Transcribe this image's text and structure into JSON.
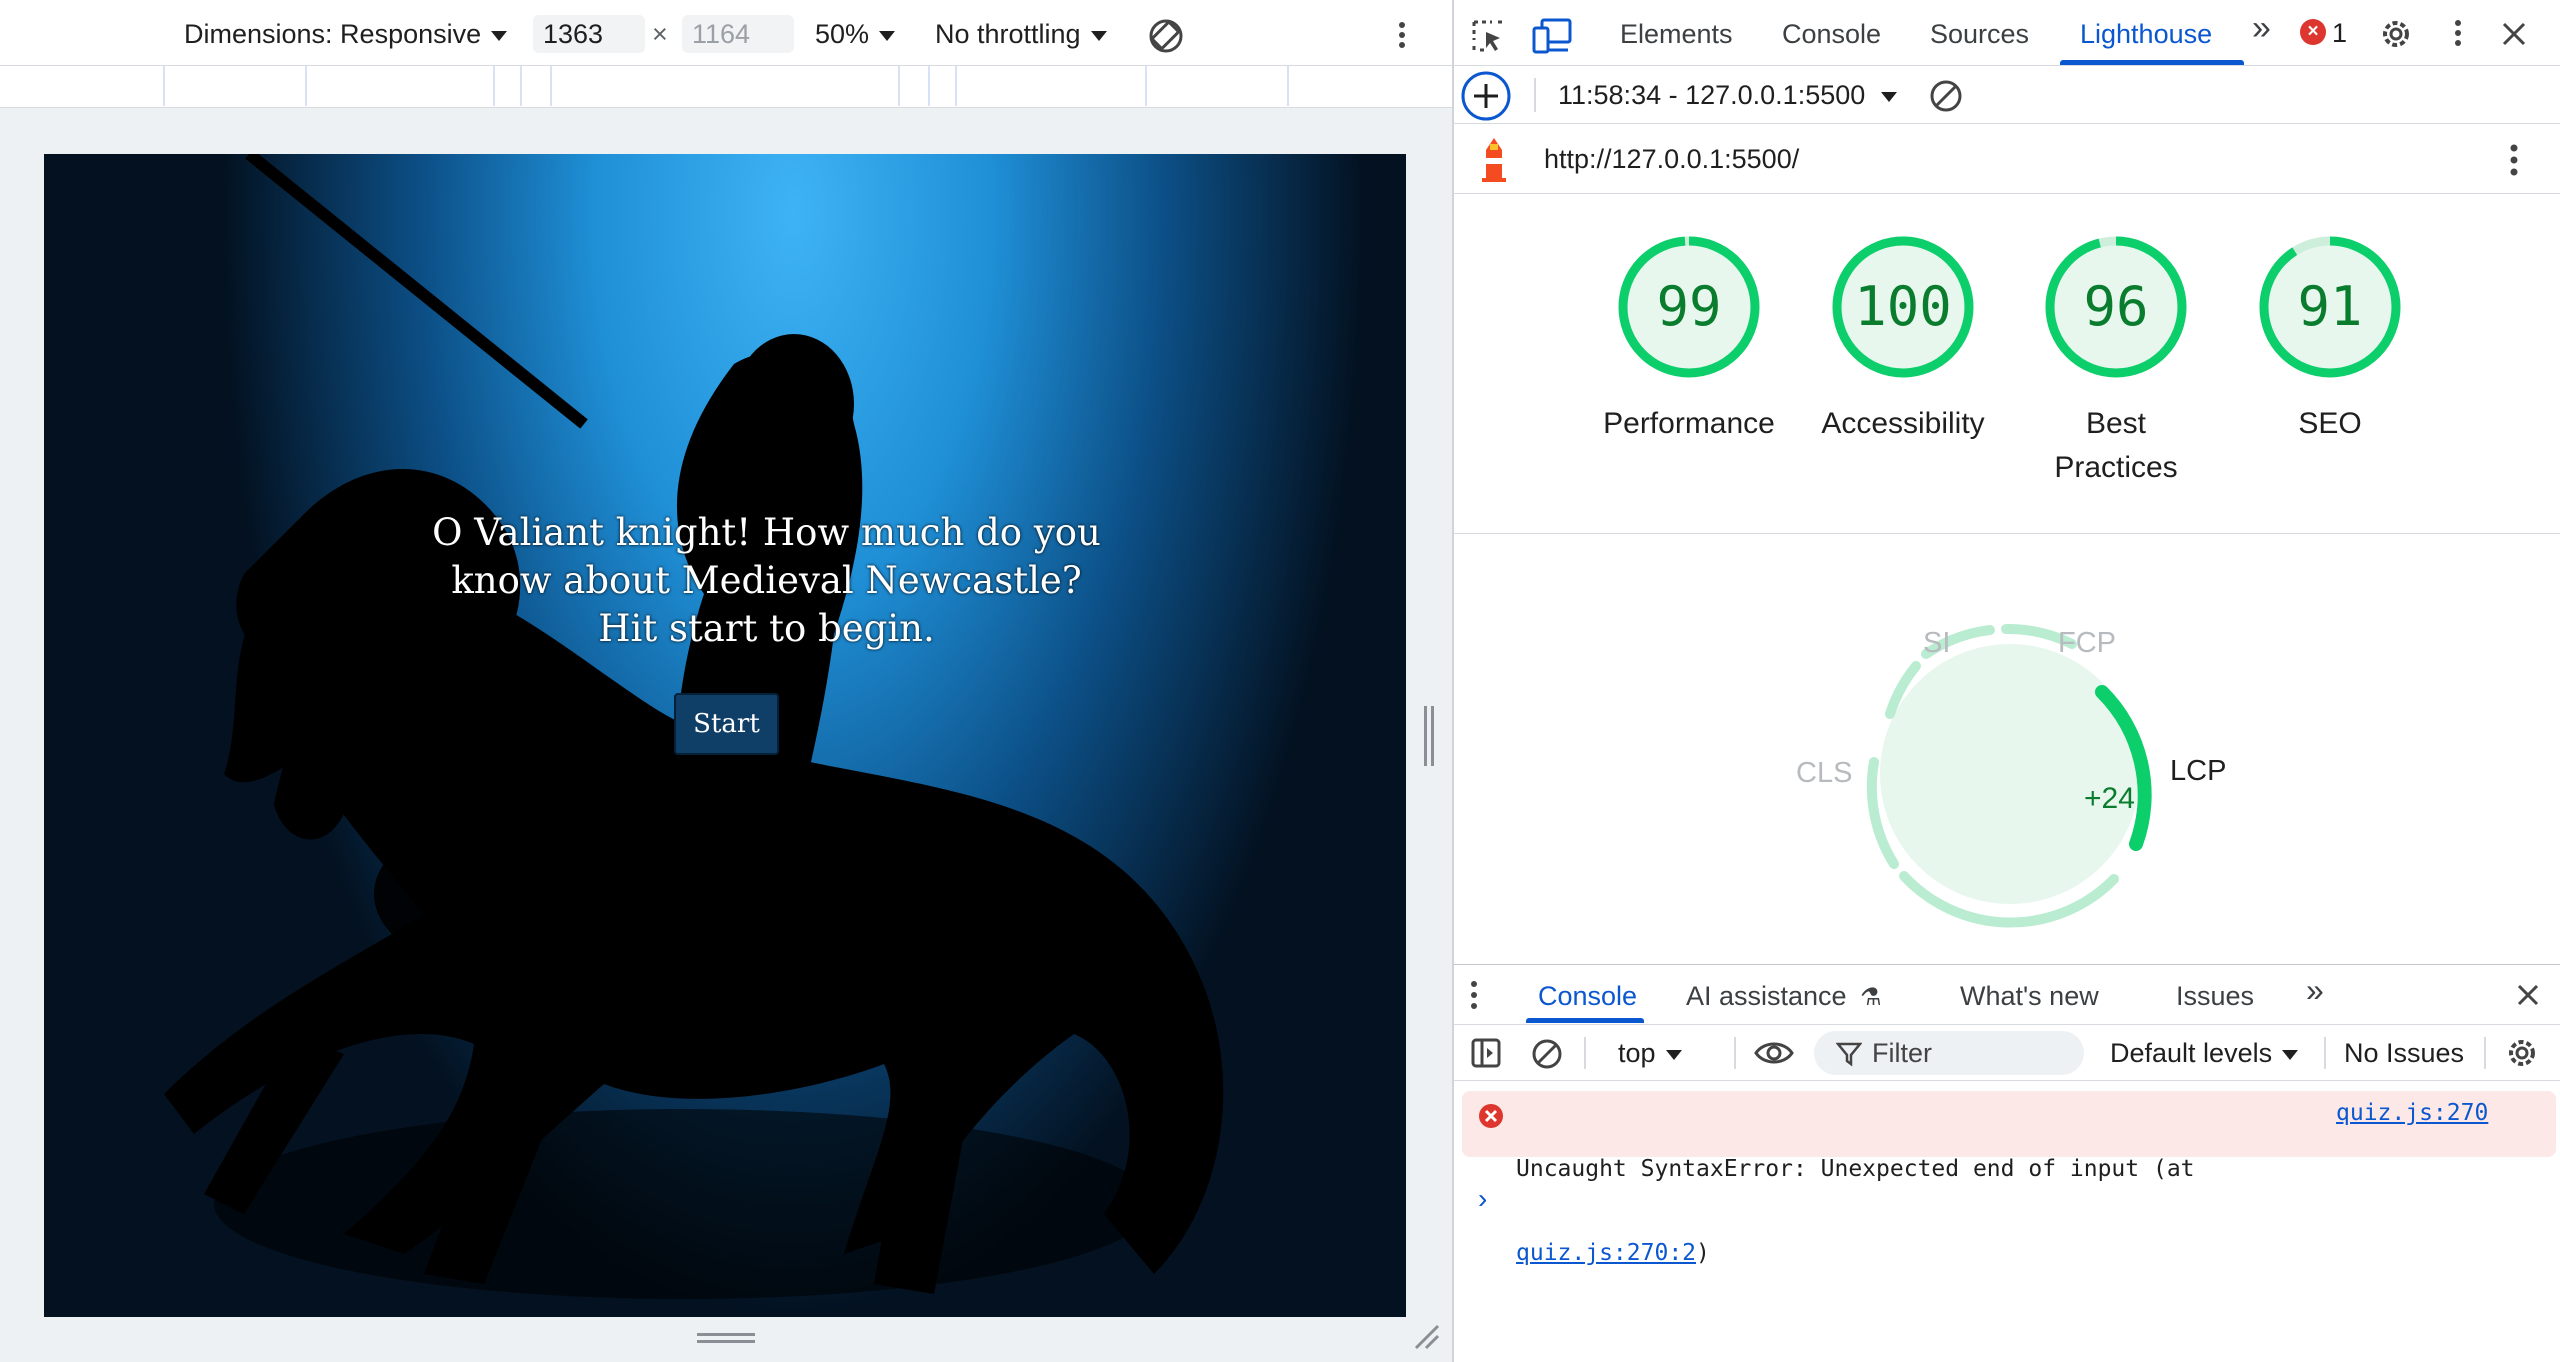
{
  "device_toolbar": {
    "dimensions_label": "Dimensions: Responsive",
    "width_value": "1363",
    "times": "×",
    "height_placeholder": "1164",
    "zoom": "50%",
    "throttling": "No throttling"
  },
  "page": {
    "heading_line1": "O Valiant knight! How much do you",
    "heading_line2": "know about Medieval Newcastle?",
    "heading_line3": "Hit start to begin.",
    "start_label": "Start"
  },
  "devtools": {
    "tabs": [
      "Elements",
      "Console",
      "Sources",
      "Lighthouse"
    ],
    "active_tab": "Lighthouse",
    "more_tabs": "»",
    "error_count": "1",
    "report_selector": "11:58:34 - 127.0.0.1:5500",
    "url": "http://127.0.0.1:5500/",
    "scores": [
      {
        "value": "99",
        "label_line1": "Performance",
        "label_line2": "",
        "fraction": 0.99
      },
      {
        "value": "100",
        "label_line1": "Accessibility",
        "label_line2": "",
        "fraction": 1.0
      },
      {
        "value": "96",
        "label_line1": "Best",
        "label_line2": "Practices",
        "fraction": 0.96
      },
      {
        "value": "91",
        "label_line1": "SEO",
        "label_line2": "",
        "fraction": 0.91
      }
    ],
    "metrics": {
      "si": "SI",
      "fcp": "FCP",
      "cls": "CLS",
      "lcp": "LCP",
      "lcp_delta": "+24"
    },
    "colors": {
      "accent": "#0b57d0",
      "pass": "#0cce6b",
      "pass_text": "#0a7c2e",
      "error": "#dc362e"
    }
  },
  "drawer": {
    "tabs": [
      "Console",
      "AI assistance",
      "What's new",
      "Issues"
    ],
    "active_tab": "Console",
    "more_tabs": "»",
    "context": "top",
    "filter_placeholder": "Filter",
    "levels": "Default levels",
    "issues": "No Issues",
    "error_message": "Uncaught SyntaxError: Unexpected end of input (at",
    "error_link_inline": "quiz.js:270:2",
    "error_close_paren": ")",
    "error_source": "quiz.js:270"
  }
}
